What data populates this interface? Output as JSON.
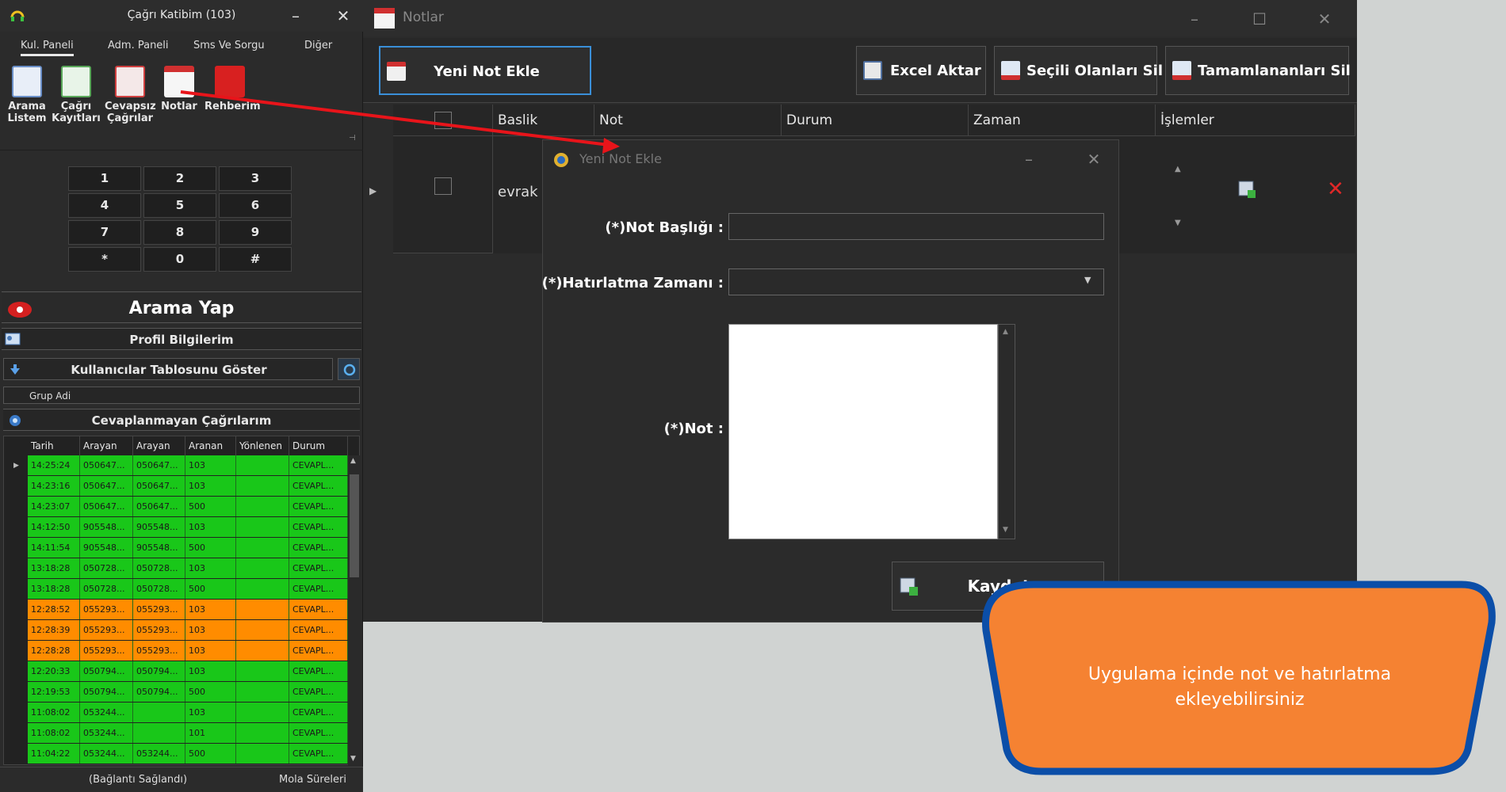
{
  "left_window": {
    "title": "Çağrı Katibim (103)",
    "tabs": [
      "Kul. Paneli",
      "Adm. Paneli",
      "Sms Ve Sorgu",
      "Diğer"
    ],
    "ribbon": [
      {
        "label": "Arama\nListem",
        "icon": "list-icon"
      },
      {
        "label": "Çağrı\nKayıtları",
        "icon": "records-icon"
      },
      {
        "label": "Cevapsız\nÇağrılar",
        "icon": "missed-calls-icon"
      },
      {
        "label": "Notlar",
        "icon": "calendar-icon"
      },
      {
        "label": "Rehberim",
        "icon": "phonebook-icon"
      }
    ],
    "dialpad": [
      "1",
      "2",
      "3",
      "4",
      "5",
      "6",
      "7",
      "8",
      "9",
      "*",
      "0",
      "#"
    ],
    "call_button": "Arama Yap",
    "profile": "Profil Bilgilerim",
    "users_toggle": "Kullanıcılar Tablosunu Göster",
    "group_header": "Grup Adi",
    "missed_calls": "Cevaplanmayan Çağrılarım",
    "calls_columns": [
      "Tarih",
      "Arayan",
      "Arayan",
      "Aranan",
      "Yönlenen",
      "Durum"
    ],
    "calls_rows": [
      {
        "time": "14:25:24",
        "a1": "050647...",
        "a2": "050647...",
        "to": "103",
        "dir": "",
        "status": "CEVAPL...",
        "color": "#19c719"
      },
      {
        "time": "14:23:16",
        "a1": "050647...",
        "a2": "050647...",
        "to": "103",
        "dir": "",
        "status": "CEVAPL...",
        "color": "#19c719"
      },
      {
        "time": "14:23:07",
        "a1": "050647...",
        "a2": "050647...",
        "to": "500",
        "dir": "",
        "status": "CEVAPL...",
        "color": "#19c719"
      },
      {
        "time": "14:12:50",
        "a1": "905548...",
        "a2": "905548...",
        "to": "103",
        "dir": "",
        "status": "CEVAPL...",
        "color": "#19c719"
      },
      {
        "time": "14:11:54",
        "a1": "905548...",
        "a2": "905548...",
        "to": "500",
        "dir": "",
        "status": "CEVAPL...",
        "color": "#19c719"
      },
      {
        "time": "13:18:28",
        "a1": "050728...",
        "a2": "050728...",
        "to": "103",
        "dir": "",
        "status": "CEVAPL...",
        "color": "#19c719"
      },
      {
        "time": "13:18:28",
        "a1": "050728...",
        "a2": "050728...",
        "to": "500",
        "dir": "",
        "status": "CEVAPL...",
        "color": "#19c719"
      },
      {
        "time": "12:28:52",
        "a1": "055293...",
        "a2": "055293...",
        "to": "103",
        "dir": "",
        "status": "CEVAPL...",
        "color": "#ff8c00"
      },
      {
        "time": "12:28:39",
        "a1": "055293...",
        "a2": "055293...",
        "to": "103",
        "dir": "",
        "status": "CEVAPL...",
        "color": "#ff8c00"
      },
      {
        "time": "12:28:28",
        "a1": "055293...",
        "a2": "055293...",
        "to": "103",
        "dir": "",
        "status": "CEVAPL...",
        "color": "#ff8c00"
      },
      {
        "time": "12:20:33",
        "a1": "050794...",
        "a2": "050794...",
        "to": "103",
        "dir": "",
        "status": "CEVAPL...",
        "color": "#19c719"
      },
      {
        "time": "12:19:53",
        "a1": "050794...",
        "a2": "050794...",
        "to": "500",
        "dir": "",
        "status": "CEVAPL...",
        "color": "#19c719"
      },
      {
        "time": "11:08:02",
        "a1": "053244...",
        "a2": "",
        "to": "103",
        "dir": "",
        "status": "CEVAPL...",
        "color": "#19c719"
      },
      {
        "time": "11:08:02",
        "a1": "053244...",
        "a2": "",
        "to": "101",
        "dir": "",
        "status": "CEVAPL...",
        "color": "#19c719"
      },
      {
        "time": "11:04:22",
        "a1": "053244...",
        "a2": "053244...",
        "to": "500",
        "dir": "",
        "status": "CEVAPL...",
        "color": "#19c719"
      }
    ],
    "status_left": "(Bağlantı Sağlandı)",
    "status_right": "Mola Süreleri"
  },
  "notlar_window": {
    "title": "Notlar",
    "buttons": {
      "new_note": "Yeni Not Ekle",
      "excel": "Excel Aktar",
      "delete_selected": "Seçili Olanları Sil",
      "delete_completed": "Tamamlananları Sil"
    },
    "columns": [
      "Baslik",
      "Not",
      "Durum",
      "Zaman",
      "İşlemler"
    ],
    "row_title": "evrak"
  },
  "dialog": {
    "title": "Yeni Not Ekle",
    "label_title": "(*)Not Başlığı :",
    "label_time": "(*)Hatırlatma Zamanı :",
    "label_note": "(*)Not :",
    "save": "Kaydet"
  },
  "callout": {
    "text": "Uygulama içinde not ve hatırlatma ekleyebilirsiniz",
    "fill": "#f58232",
    "border": "#0b4ea8"
  },
  "colors": {
    "arrow": "#e8141a",
    "accent_blue": "#3a8fd8"
  }
}
